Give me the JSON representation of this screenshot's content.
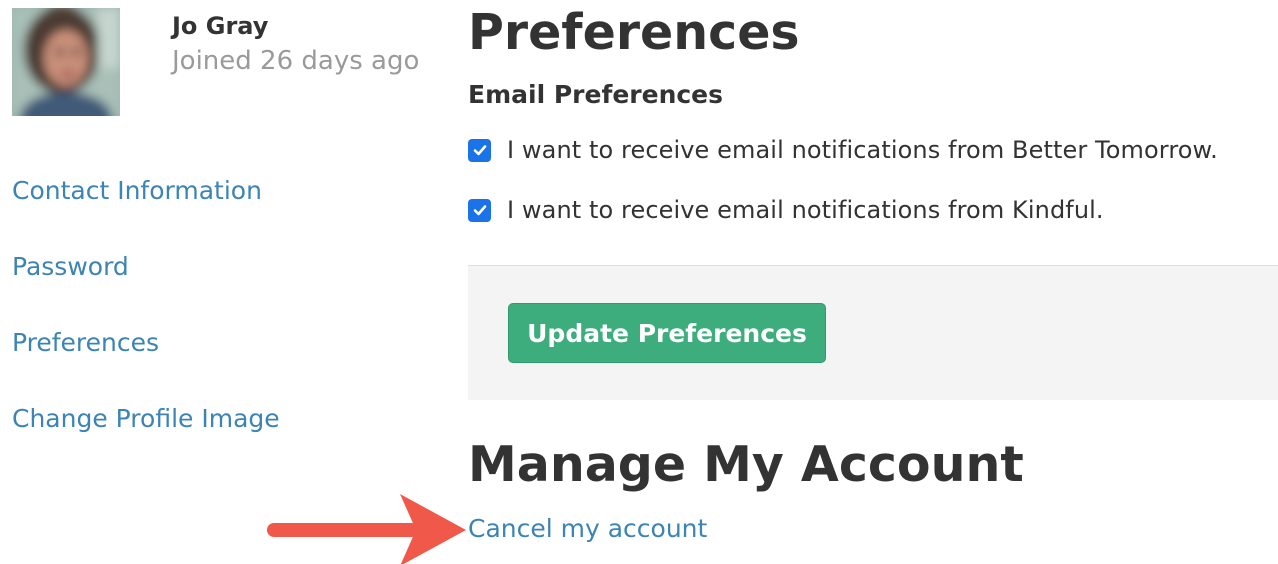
{
  "profile": {
    "name": "Jo Gray",
    "joined": "Joined 26 days ago"
  },
  "sidebar": {
    "items": [
      {
        "label": "Contact Information"
      },
      {
        "label": "Password"
      },
      {
        "label": "Preferences"
      },
      {
        "label": "Change Profile Image"
      }
    ]
  },
  "main": {
    "title": "Preferences",
    "email_section": {
      "title": "Email Preferences",
      "options": [
        {
          "label": "I want to receive email notifications from Better Tomorrow.",
          "checked": true
        },
        {
          "label": "I want to receive email notifications from Kindful.",
          "checked": true
        }
      ]
    },
    "update_button": "Update Preferences",
    "manage": {
      "title": "Manage My Account",
      "cancel_link": "Cancel my account"
    }
  },
  "colors": {
    "link": "#3c84b3",
    "button": "#3ead7e",
    "checkbox": "#1a73e8",
    "annotation_arrow": "#f0584a"
  },
  "icons": {
    "checkbox_checked": "checkmark-icon",
    "annotation": "arrow-right-icon"
  }
}
